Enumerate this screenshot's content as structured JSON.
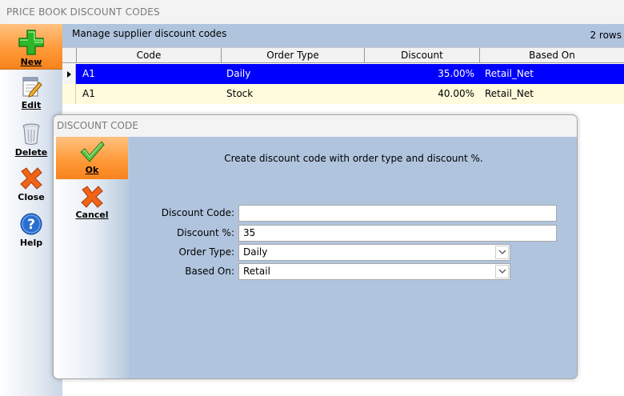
{
  "window": {
    "title": "PRICE BOOK DISCOUNT CODES"
  },
  "toolbar": {
    "new_label": "New",
    "edit_label": "Edit",
    "delete_label": "Delete",
    "close_label": "Close",
    "help_label": "Help",
    "icons": [
      "plus-icon",
      "notepad-pencil-icon",
      "trash-can-icon",
      "close-x-icon",
      "help-question-icon"
    ]
  },
  "grid": {
    "caption": "Manage supplier discount codes",
    "row_count": "2 rows",
    "columns": [
      "Code",
      "Order Type",
      "Discount",
      "Based On"
    ],
    "rows": [
      {
        "code": "A1",
        "order_type": "Daily",
        "discount": "35.00%",
        "based_on": "Retail_Net"
      },
      {
        "code": "A1",
        "order_type": "Stock",
        "discount": "40.00%",
        "based_on": "Retail_Net"
      }
    ]
  },
  "dialog": {
    "title": "DISCOUNT CODE",
    "ok_label": "Ok",
    "cancel_label": "Cancel",
    "message": "Create discount code with order type and discount %.",
    "fields": {
      "discount_code": {
        "label": "Discount Code:",
        "value": ""
      },
      "discount_pct": {
        "label": "Discount %:",
        "value": "35"
      },
      "order_type": {
        "label": "Order Type:",
        "value": "Daily"
      },
      "based_on": {
        "label": "Based On:",
        "value": "Retail"
      }
    }
  },
  "colors": {
    "selected_row": "#0000ff",
    "alt_row": "#fffbdc",
    "panel_blue": "#b0c4de",
    "button_orange": "#ff9a3a"
  }
}
